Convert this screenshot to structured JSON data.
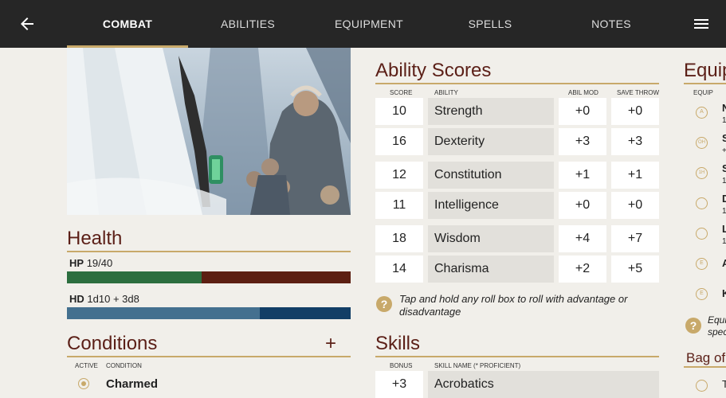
{
  "tabs": [
    {
      "label": "COMBAT",
      "active": true
    },
    {
      "label": "ABILITIES",
      "active": false
    },
    {
      "label": "EQUIPMENT",
      "active": false
    },
    {
      "label": "SPELLS",
      "active": false
    },
    {
      "label": "NOTES",
      "active": false
    }
  ],
  "icons": {
    "back": "arrow-left-icon",
    "menu": "hamburger-menu-icon"
  },
  "colors": {
    "accent": "#c8a96a",
    "title": "#5b1f17",
    "hp_fill": "#2c6e3f",
    "hp_empty": "#5c1f12",
    "hd_fill": "#44708f",
    "hd_empty": "#123e66"
  },
  "health": {
    "title": "Health",
    "hp_label": "HP",
    "hp_value": "19/40",
    "hp_fraction": 0.475,
    "hd_label": "HD",
    "hd_value": "1d10 + 3d8",
    "hd_fraction": 0.68
  },
  "conditions": {
    "title": "Conditions",
    "add_label": "+",
    "col_active": "ACTIVE",
    "col_condition": "CONDITION",
    "items": [
      {
        "name": "Charmed",
        "active": true
      }
    ]
  },
  "ability_scores": {
    "title": "Ability Scores",
    "col_score": "SCORE",
    "col_ability": "ABILITY",
    "col_mod": "ABIL MOD",
    "col_save": "SAVE THROW",
    "rows": [
      {
        "score": "10",
        "ability": "Strength",
        "mod": "+0",
        "save": "+0"
      },
      {
        "score": "16",
        "ability": "Dexterity",
        "mod": "+3",
        "save": "+3"
      },
      {
        "score": "12",
        "ability": "Constitution",
        "mod": "+1",
        "save": "+1"
      },
      {
        "score": "11",
        "ability": "Intelligence",
        "mod": "+0",
        "save": "+0"
      },
      {
        "score": "18",
        "ability": "Wisdom",
        "mod": "+4",
        "save": "+7"
      },
      {
        "score": "14",
        "ability": "Charisma",
        "mod": "+2",
        "save": "+5"
      }
    ],
    "hint": "Tap and hold any roll box to roll with advantage or disadvantage"
  },
  "skills": {
    "title": "Skills",
    "col_bonus": "BONUS",
    "col_name": "SKILL NAME (* PROFICIENT)",
    "rows": [
      {
        "bonus": "+3",
        "name": "Acrobatics"
      }
    ]
  },
  "equipment": {
    "title": "Equip",
    "col_equip": "EQUIP",
    "slots": [
      {
        "badge": "A",
        "line1": "N",
        "line2": "1"
      },
      {
        "badge": "OH",
        "line1": "S",
        "line2": "+"
      },
      {
        "badge": "1H",
        "line1": "S",
        "line2": "1"
      },
      {
        "badge": "",
        "line1": "D",
        "line2": "1"
      },
      {
        "badge": "",
        "line1": "L",
        "line2": "1"
      },
      {
        "badge": "E",
        "line1": "A",
        "line2": ""
      },
      {
        "badge": "E",
        "line1": "K",
        "line2": ""
      }
    ],
    "hint_line1": "Equi",
    "hint_line2": "spec",
    "bag_title": "Bag of",
    "bag_item": "T"
  }
}
